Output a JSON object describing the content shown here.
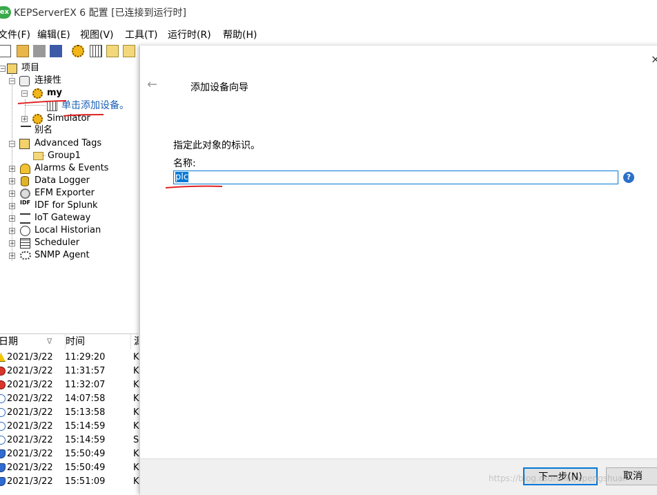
{
  "window": {
    "title": "KEPServerEX 6 配置 [已连接到运行时]",
    "logo_text": "ex"
  },
  "menu": [
    "文件(F)",
    "编辑(E)",
    "视图(V)",
    "工具(T)",
    "运行时(R)",
    "帮助(H)"
  ],
  "tree": {
    "root": "项目",
    "connectivity": "连接性",
    "channel_my": "my",
    "add_device_link": "单击添加设备。",
    "simulator": "Simulator",
    "aliases": "别名",
    "advanced_tags": "Advanced Tags",
    "group1": "Group1",
    "plugins": [
      "Alarms & Events",
      "Data Logger",
      "EFM Exporter",
      "IDF for Splunk",
      "IoT Gateway",
      "Local Historian",
      "Scheduler",
      "SNMP Agent"
    ]
  },
  "log": {
    "headers": {
      "date": "日期",
      "time": "时间",
      "source": "源"
    },
    "rows": [
      {
        "severity": "warning",
        "date": "2021/3/22",
        "time": "11:29:20",
        "source": "K"
      },
      {
        "severity": "error",
        "date": "2021/3/22",
        "time": "11:31:57",
        "source": "K"
      },
      {
        "severity": "error",
        "date": "2021/3/22",
        "time": "11:32:07",
        "source": "K"
      },
      {
        "severity": "info",
        "date": "2021/3/22",
        "time": "14:07:58",
        "source": "K"
      },
      {
        "severity": "info",
        "date": "2021/3/22",
        "time": "15:13:58",
        "source": "K"
      },
      {
        "severity": "info",
        "date": "2021/3/22",
        "time": "15:14:59",
        "source": "K"
      },
      {
        "severity": "info",
        "date": "2021/3/22",
        "time": "15:14:59",
        "source": "S"
      },
      {
        "severity": "security",
        "date": "2021/3/22",
        "time": "15:50:49",
        "source": "K"
      },
      {
        "severity": "security",
        "date": "2021/3/22",
        "time": "15:50:49",
        "source": "K"
      },
      {
        "severity": "security",
        "date": "2021/3/22",
        "time": "15:51:09",
        "source": "K"
      }
    ]
  },
  "dialog": {
    "title": "添加设备向导",
    "close_label": "×",
    "back_label": "←",
    "prompt": "指定此对象的标识。",
    "name_label": "名称:",
    "name_value": "plc",
    "help_label": "?",
    "next_button": "下一步(N)",
    "cancel_button": "取消"
  },
  "watermark": "https://blog.csdn.net/xpengshuai",
  "colors": {
    "accent": "#0078d7",
    "annotation": "#e02020",
    "logo": "#3aa84a"
  }
}
